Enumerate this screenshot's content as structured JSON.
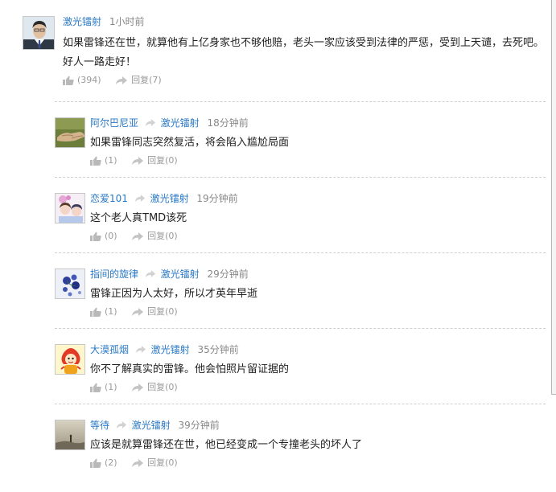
{
  "colors": {
    "link": "#2a79c7",
    "time": "#888888",
    "muted": "#999999",
    "text": "#222222",
    "separator": "#cfcfcf"
  },
  "top_comment": {
    "user": "激光镭射",
    "time": "1小时前",
    "text": "如果雷锋还在世，就算他有上亿身家也不够他赔，老头一家应该受到法律的严惩，受到上天谴，去死吧。好人一路走好！",
    "likes": "(394)",
    "reply_label": "回复",
    "reply_count": "(7)",
    "avatar": "man-in-suit-photo"
  },
  "replies": [
    {
      "user": "阿尔巴尼亚",
      "reply_to": "激光镭射",
      "time": "18分钟前",
      "text": "如果雷锋同志突然复活，将会陷入尴尬局面",
      "likes": "(1)",
      "reply_label": "回复",
      "reply_count": "(0)",
      "avatar": "handshake-photo"
    },
    {
      "user": "恋爱101",
      "reply_to": "激光镭射",
      "time": "19分钟前",
      "text": "这个老人真TMD该死",
      "likes": "(0)",
      "reply_label": "回复",
      "reply_count": "(0)",
      "avatar": "cartoon-couple"
    },
    {
      "user": "指间的旋律",
      "reply_to": "激光镭射",
      "time": "29分钟前",
      "text": "雷锋正因为人太好，所以才英年早逝",
      "likes": "(1)",
      "reply_label": "回复",
      "reply_count": "(0)",
      "avatar": "blue-flowers"
    },
    {
      "user": "大漠孤烟",
      "reply_to": "激光镭射",
      "time": "35分钟前",
      "text": "你不了解真实的雷锋。他会怕照片留证据的",
      "likes": "(1)",
      "reply_label": "回复",
      "reply_count": "(0)",
      "avatar": "olympic-mascot"
    },
    {
      "user": "等待",
      "reply_to": "激光镭射",
      "time": "39分钟前",
      "text": "应该是就算雷锋还在世，他已经变成一个专撞老头的坏人了",
      "likes": "(2)",
      "reply_label": "回复",
      "reply_count": "(0)",
      "avatar": "foggy-landscape"
    }
  ]
}
